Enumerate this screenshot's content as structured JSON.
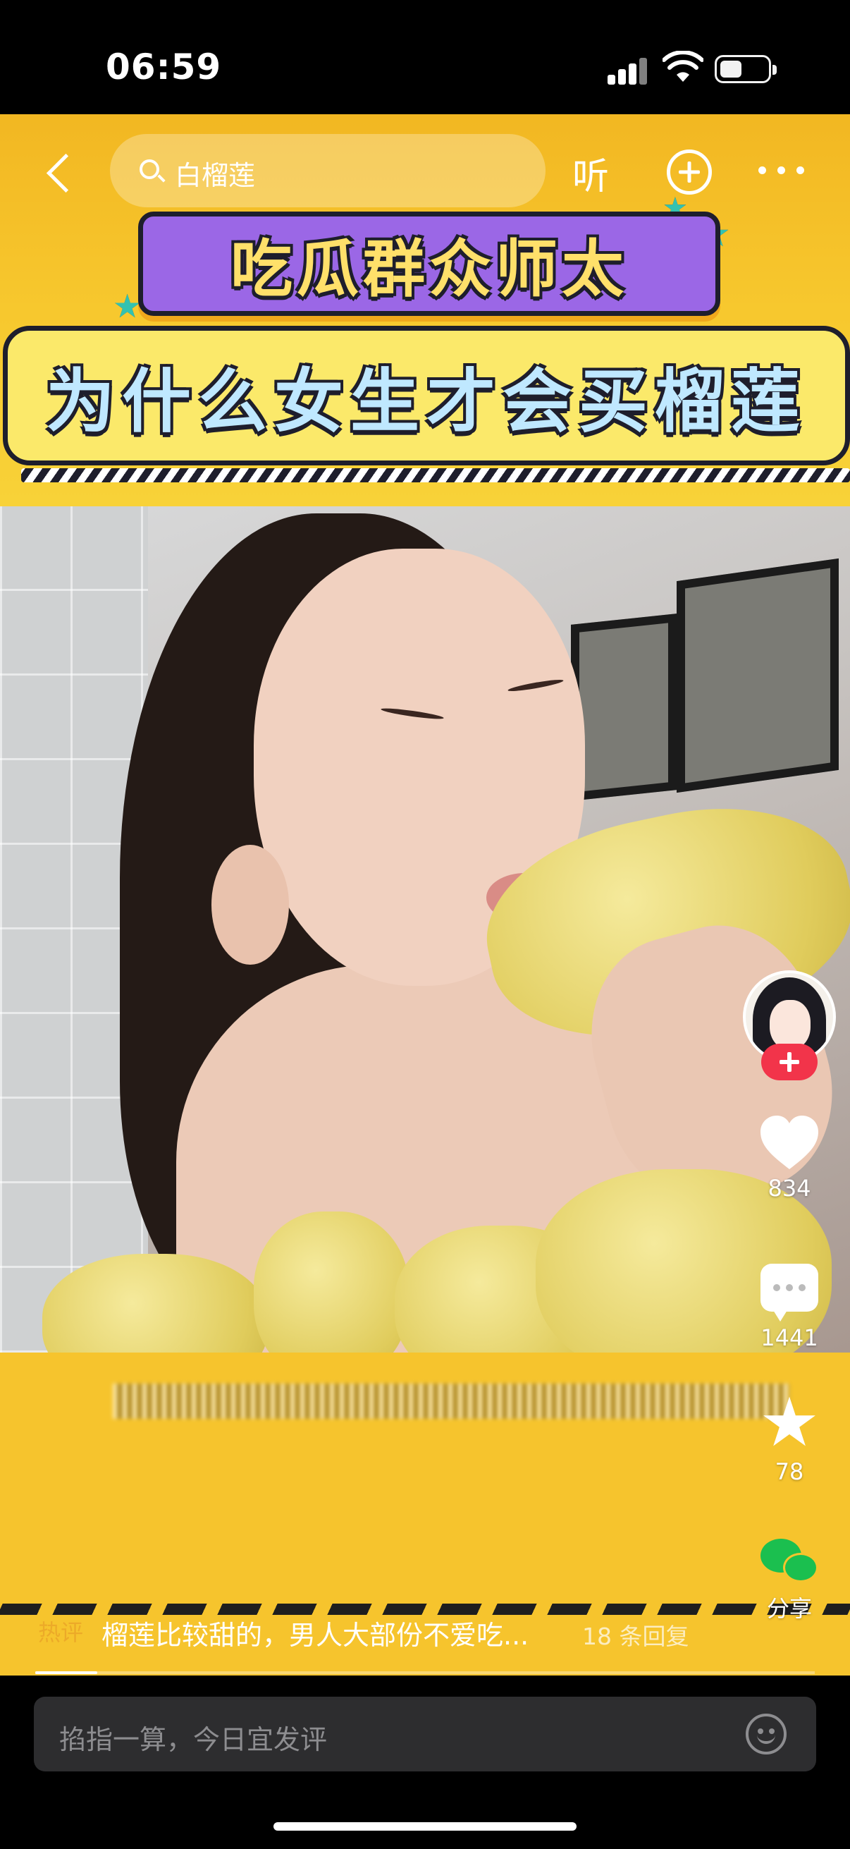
{
  "status_bar": {
    "time": "06:59"
  },
  "top_nav": {
    "search_text": "白榴莲",
    "listen_label": "听"
  },
  "video": {
    "banner_subtitle": "吃瓜群众师太",
    "banner_title": "为什么女生才会买榴莲"
  },
  "actions": {
    "likes": "834",
    "comments": "1441",
    "favorites": "78",
    "share_label": "分享"
  },
  "comment_preview": {
    "text": "榴莲比较甜的，男人大部份不爱吃...",
    "replies": "18 条回复"
  },
  "playback": {
    "progress": 0.08
  },
  "comment_bar": {
    "placeholder": "掐指一算，今日宜发评"
  }
}
